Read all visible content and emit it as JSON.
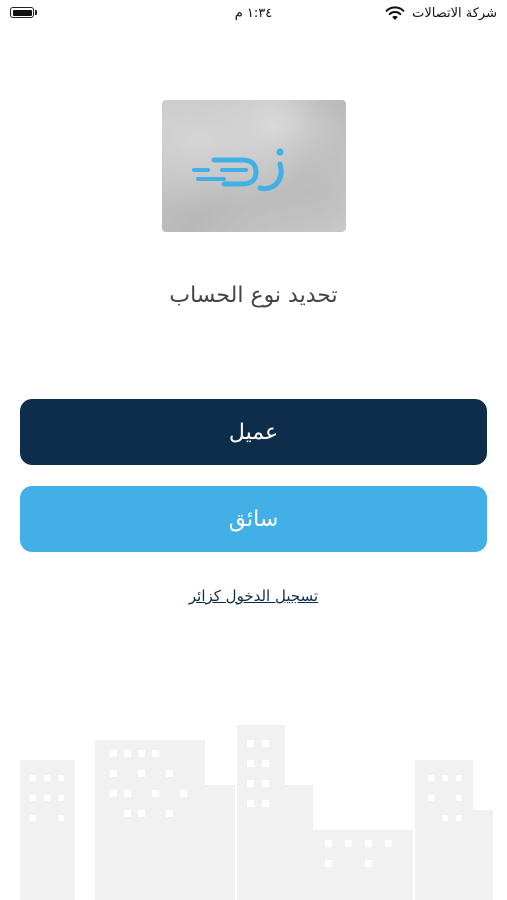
{
  "status_bar": {
    "carrier": "شركة الاتصالات",
    "time": "١:٣٤ م"
  },
  "logo": {
    "icon": "zd-logo-icon",
    "color": "#42afe6"
  },
  "title": "تحديد نوع الحساب",
  "buttons": {
    "client_label": "عميل",
    "driver_label": "سائق"
  },
  "guest_link": "تسجيل الدخول كزائر",
  "colors": {
    "primary": "#0e2d4a",
    "accent": "#42afe6"
  }
}
